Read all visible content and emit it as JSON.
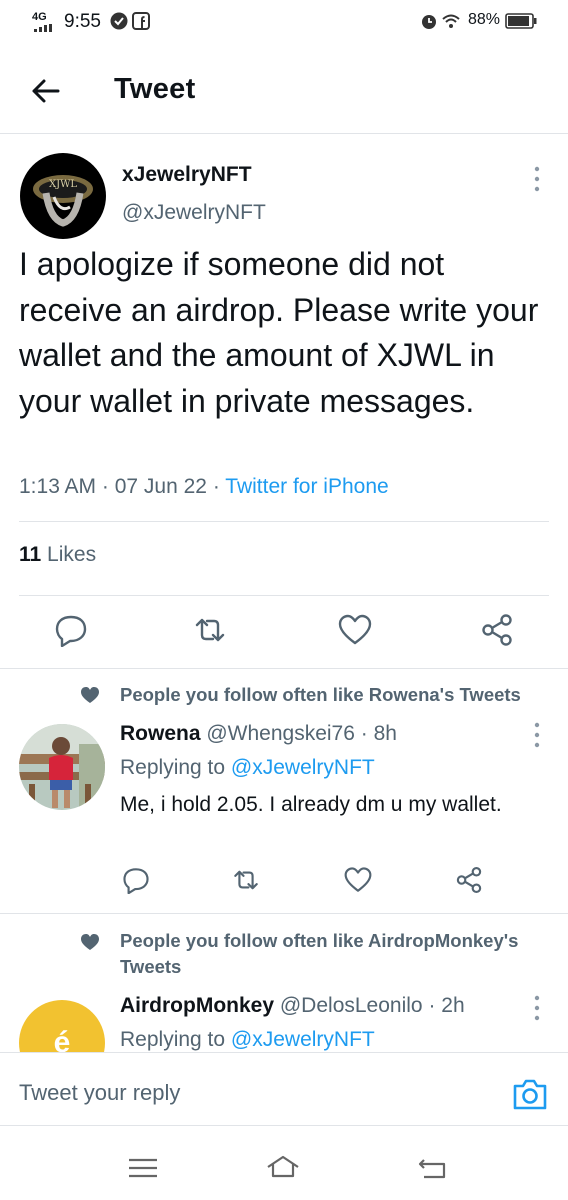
{
  "status_bar": {
    "network": "4G",
    "time": "9:55",
    "battery": "88%",
    "icons": [
      "signal-icon",
      "sync-icon",
      "facebook-icon",
      "alarm-icon",
      "wifi-icon",
      "battery-icon"
    ]
  },
  "header": {
    "title": "Tweet",
    "back_icon": "arrow-left-icon"
  },
  "tweet": {
    "author_name": "xJewelryNFT",
    "author_handle": "@xJewelryNFT",
    "avatar_logo_text": "XJWL",
    "text": "I apologize if someone did not receive an airdrop.  Please write your wallet and the amount of XJWL in your wallet in private messages.",
    "time": "1:13 AM",
    "date": "07 Jun 22",
    "source": "Twitter for iPhone",
    "likes_count": "11",
    "likes_label": "Likes",
    "actions": [
      "reply-icon",
      "retweet-icon",
      "like-icon",
      "share-icon"
    ]
  },
  "replies": [
    {
      "social_context": "People you follow often like Rowena's Tweets",
      "name": "Rowena",
      "handle": "@Whengskei76",
      "age": "8h",
      "replying_prefix": "Replying to",
      "replying_to": "@xJewelryNFT",
      "text": "Me,  i hold 2.05. I already dm u my wallet."
    },
    {
      "social_context": "People you follow often like AirdropMonkey's Tweets",
      "name": "AirdropMonkey",
      "handle": "@DelosLeonilo",
      "age": "2h",
      "replying_prefix": "Replying to",
      "replying_to": "@xJewelryNFT",
      "avatar_glyph": "é"
    }
  ],
  "compose": {
    "placeholder": "Tweet your reply",
    "camera_icon": "camera-icon"
  },
  "nav_bar": {
    "icons": [
      "recent-apps-icon",
      "home-icon",
      "back-icon"
    ]
  },
  "colors": {
    "accent": "#1d9bf0",
    "secondary_text": "#536471",
    "primary_text": "#0f1419",
    "divider": "#e1e4e8"
  }
}
